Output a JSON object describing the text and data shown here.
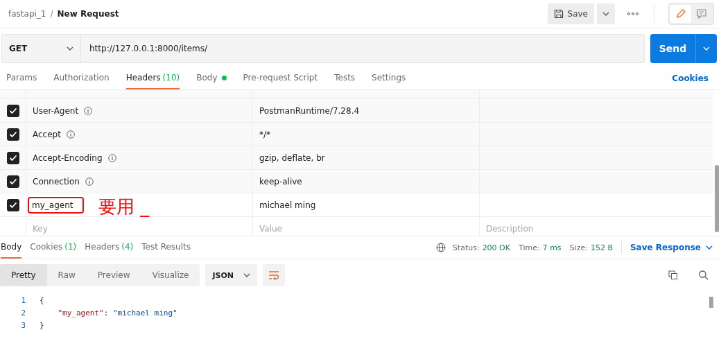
{
  "breadcrumb": {
    "collection": "fastapi_1",
    "separator": "/",
    "request": "New Request"
  },
  "save_button": "Save",
  "request": {
    "method": "GET",
    "url": "http://127.0.0.1:8000/items/",
    "send": "Send"
  },
  "request_tabs": [
    {
      "label": "Params",
      "selected": false
    },
    {
      "label": "Authorization",
      "selected": false
    },
    {
      "label": "Headers",
      "count": "(10)",
      "selected": true
    },
    {
      "label": "Body",
      "dot": true,
      "selected": false
    },
    {
      "label": "Pre-request Script",
      "selected": false
    },
    {
      "label": "Tests",
      "selected": false
    },
    {
      "label": "Settings",
      "selected": false
    }
  ],
  "cookies_link": "Cookies",
  "headers": [
    {
      "key": "User-Agent",
      "value": "PostmanRuntime/7.28.4",
      "checked": true,
      "kind": "auto"
    },
    {
      "key": "Accept",
      "value": "*/*",
      "checked": true,
      "kind": "auto"
    },
    {
      "key": "Accept-Encoding",
      "value": "gzip, deflate, br",
      "checked": true,
      "kind": "auto"
    },
    {
      "key": "Connection",
      "value": "keep-alive",
      "checked": true,
      "kind": "auto"
    },
    {
      "key": "my_agent",
      "value": "michael ming",
      "checked": true,
      "kind": "custom",
      "highlighted": true
    }
  ],
  "new_row": {
    "key": "Key",
    "value": "Value",
    "description": "Description"
  },
  "annotation": "要用 _",
  "response_tabs": [
    {
      "label": "Body",
      "selected": true
    },
    {
      "label": "Cookies",
      "count": "(1)",
      "selected": false
    },
    {
      "label": "Headers",
      "count": "(4)",
      "selected": false
    },
    {
      "label": "Test Results",
      "selected": false
    }
  ],
  "status": {
    "status_label": "Status:",
    "status": "200 OK",
    "time_label": "Time:",
    "time": "7 ms",
    "size_label": "Size:",
    "size": "152 B",
    "save_response": "Save Response"
  },
  "view_tabs": [
    {
      "label": "Pretty",
      "selected": true
    },
    {
      "label": "Raw",
      "selected": false
    },
    {
      "label": "Preview",
      "selected": false
    },
    {
      "label": "Visualize",
      "selected": false
    }
  ],
  "format": "JSON",
  "code": [
    {
      "num": "1",
      "indented": false,
      "tokens": [
        {
          "t": "{",
          "kind": "punct"
        }
      ]
    },
    {
      "num": "2",
      "indented": true,
      "tokens": [
        {
          "t": "\"my_agent\"",
          "kind": "key"
        },
        {
          "t": ": ",
          "kind": "punct"
        },
        {
          "t": "\"michael ming\"",
          "kind": "string"
        }
      ]
    },
    {
      "num": "3",
      "indented": false,
      "tokens": [
        {
          "t": "}",
          "kind": "punct"
        }
      ]
    }
  ]
}
